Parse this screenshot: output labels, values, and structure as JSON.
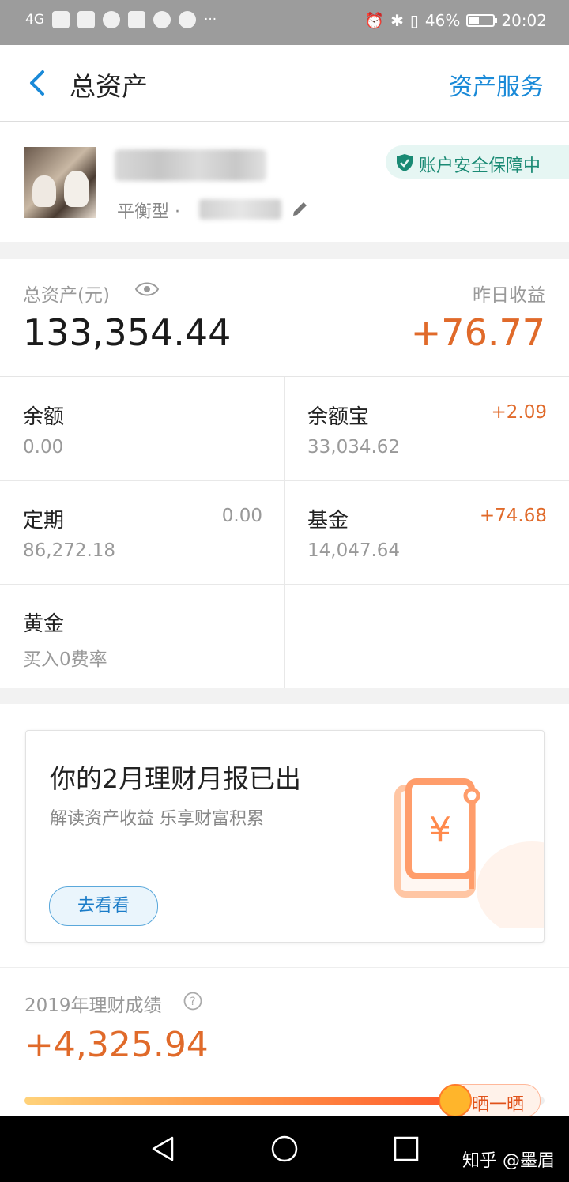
{
  "status_bar": {
    "signal_text": "4G",
    "battery": "46%",
    "battery_level": 0.46,
    "time": "20:02"
  },
  "header": {
    "title": "总资产",
    "service_link": "资产服务"
  },
  "profile": {
    "risk_type": "平衡型 ·",
    "security_badge": "账户安全保障中"
  },
  "summary": {
    "total_label": "总资产(元)",
    "total_value": "133,354.44",
    "yesterday_label": "昨日收益",
    "yesterday_value": "+76.77"
  },
  "assets": [
    {
      "name": "余额",
      "value": "0.00",
      "delta": ""
    },
    {
      "name": "余额宝",
      "value": "33,034.62",
      "delta": "+2.09"
    },
    {
      "name": "定期",
      "value": "86,272.18",
      "delta": "0.00"
    },
    {
      "name": "基金",
      "value": "14,047.64",
      "delta": "+74.68"
    },
    {
      "name": "黄金",
      "value": "买入0费率",
      "delta": ""
    }
  ],
  "report": {
    "title": "你的2月理财月报已出",
    "subtitle": "解读资产收益 乐享财富积累",
    "button": "去看看"
  },
  "performance": {
    "label": "2019年理财成绩",
    "value": "+4,325.94",
    "progress": 0.83,
    "share_button": "晒一晒"
  },
  "watermark": "知乎 @墨眉",
  "colors": {
    "accent_blue": "#1a8ad8",
    "gain_orange": "#e06a2a",
    "secure_green": "#1a8a74"
  }
}
